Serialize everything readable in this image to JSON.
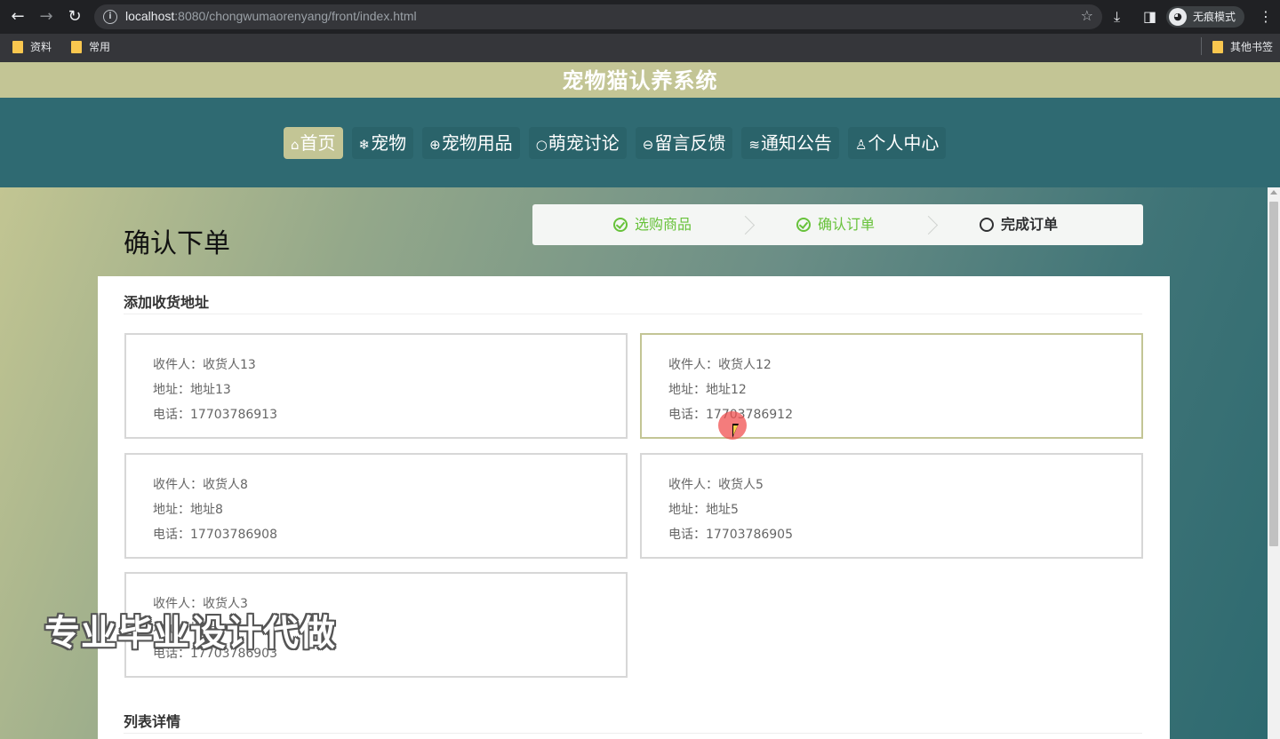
{
  "browser": {
    "url_host": "localhost",
    "url_rest": ":8080/chongwumaorenyang/front/index.html",
    "incognito_label": "无痕模式",
    "bookmarks": [
      "资料",
      "常用"
    ],
    "other_bookmarks": "其他书签"
  },
  "site": {
    "title": "宠物猫认养系统",
    "menu": [
      {
        "icon": "⌂",
        "label": "首页",
        "active": true
      },
      {
        "icon": "❄",
        "label": "宠物",
        "active": false
      },
      {
        "icon": "⊕",
        "label": "宠物用品",
        "active": false
      },
      {
        "icon": "○",
        "label": "萌宠讨论",
        "active": false
      },
      {
        "icon": "⊖",
        "label": "留言反馈",
        "active": false
      },
      {
        "icon": "≋",
        "label": "通知公告",
        "active": false
      },
      {
        "icon": "♙",
        "label": "个人中心",
        "active": false
      }
    ]
  },
  "page": {
    "heading": "确认下单",
    "steps": [
      {
        "label": "选购商品",
        "status": "done"
      },
      {
        "label": "确认订单",
        "status": "done"
      },
      {
        "label": "完成订单",
        "status": "current"
      }
    ],
    "address_section_title": "添加收货地址",
    "addresses": [
      {
        "receiver": "收件人：收货人13",
        "address": "地址：地址13",
        "phone": "电话：17703786913",
        "selected": false
      },
      {
        "receiver": "收件人：收货人12",
        "address": "地址：地址12",
        "phone": "电话：17703786912",
        "selected": true
      },
      {
        "receiver": "收件人：收货人8",
        "address": "地址：地址8",
        "phone": "电话：17703786908",
        "selected": false
      },
      {
        "receiver": "收件人：收货人5",
        "address": "地址：地址5",
        "phone": "电话：17703786905",
        "selected": false
      },
      {
        "receiver": "收件人：收货人3",
        "address": "地址：地址3",
        "phone": "电话：17703786903",
        "selected": false
      }
    ],
    "list_section_title": "列表详情"
  },
  "overlay": {
    "watermark": "专业毕业设计代做"
  },
  "colors": {
    "accent": "#c3c595",
    "menu_bg": "#2f6a72",
    "step_done": "#67c23a"
  }
}
